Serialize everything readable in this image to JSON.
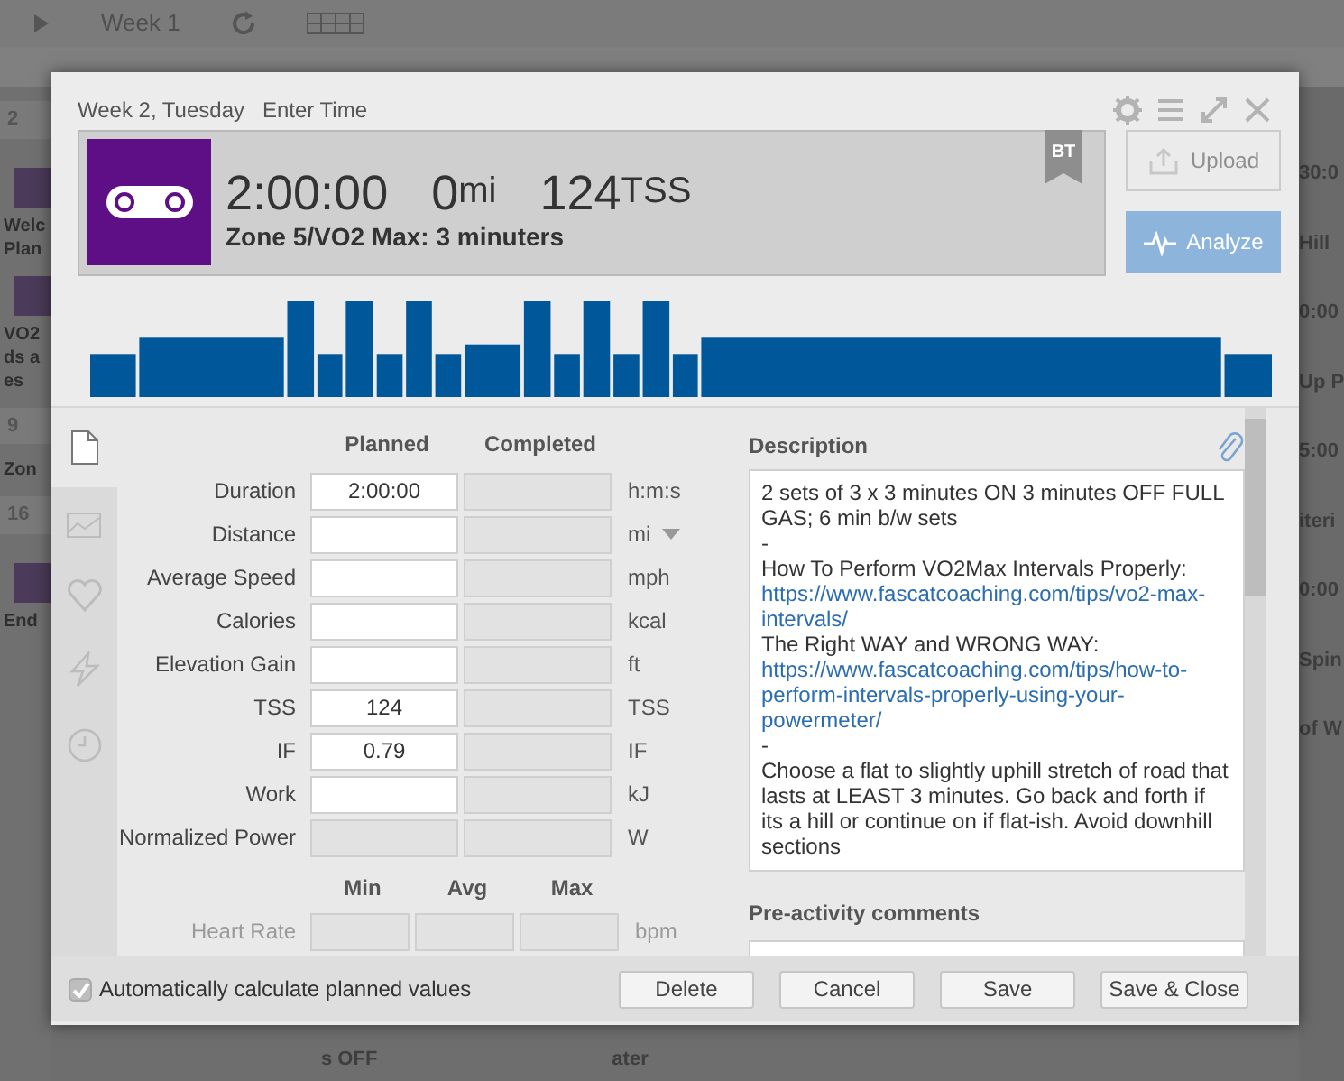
{
  "background": {
    "week_label": "Week 1",
    "left_column": [
      {
        "kind": "daynum",
        "text": "2"
      },
      {
        "kind": "icon"
      },
      {
        "kind": "text",
        "text": "Welc"
      },
      {
        "kind": "text",
        "text": "Plan"
      },
      {
        "kind": "icon"
      },
      {
        "kind": "text",
        "text": "VO2"
      },
      {
        "kind": "text",
        "text": "ds a"
      },
      {
        "kind": "text",
        "text": "es"
      },
      {
        "kind": "daynum",
        "text": "9"
      },
      {
        "kind": "text",
        "text": "Zon"
      },
      {
        "kind": "daynum",
        "text": "16"
      },
      {
        "kind": "icon"
      },
      {
        "kind": "text",
        "text": "End"
      }
    ],
    "right_column": [
      {
        "text": "30:0"
      },
      {
        "text": "Hill"
      },
      {
        "text": "0:00"
      },
      {
        "text": "Up P"
      },
      {
        "text": "5:00"
      },
      {
        "text": "iteri"
      },
      {
        "text": "0:00"
      },
      {
        "text": "Spin"
      },
      {
        "text": "of W"
      }
    ],
    "bottom_texts": [
      "s OFF",
      "ater"
    ]
  },
  "dialog": {
    "breadcrumb": "Week 2, Tuesday",
    "time_link": "Enter Time",
    "summary": {
      "duration": "2:00:00",
      "distance": "0",
      "distance_unit": "mi",
      "tss": "124",
      "tss_unit": "TSS",
      "title": "Zone 5/VO2 Max: 3 minuters",
      "badge": "BT"
    },
    "actions": [
      {
        "label": "Upload",
        "disabled": true
      },
      {
        "label": "Analyze",
        "disabled": false
      }
    ],
    "planned_header": "Planned",
    "completed_header": "Completed",
    "metrics": [
      {
        "label": "Duration",
        "planned": "2:00:00",
        "unit": "h:m:s",
        "planned_disabled": false
      },
      {
        "label": "Distance",
        "unit": "mi",
        "planned_disabled": false,
        "dropdown": true
      },
      {
        "label": "Average Speed",
        "unit": "mph",
        "planned_disabled": false
      },
      {
        "label": "Calories",
        "unit": "kcal",
        "planned_disabled": false
      },
      {
        "label": "Elevation Gain",
        "unit": "ft",
        "planned_disabled": false
      },
      {
        "label": "TSS",
        "planned": "124",
        "unit": "TSS",
        "planned_disabled": false
      },
      {
        "label": "IF",
        "planned": "0.79",
        "unit": "IF",
        "planned_disabled": false
      },
      {
        "label": "Work",
        "unit": "kJ",
        "planned_disabled": false
      },
      {
        "label": "Normalized Power",
        "unit": "W",
        "planned_disabled": true
      }
    ],
    "range_headers": [
      "Min",
      "Avg",
      "Max"
    ],
    "heart_rate": {
      "label": "Heart Rate",
      "unit": "bpm",
      "disabled": true
    },
    "description_label": "Description",
    "description": [
      {
        "kind": "text",
        "text": "2 sets of 3 x 3 minutes ON 3 minutes OFF FULL GAS; 6 min b/w sets"
      },
      {
        "kind": "text",
        "text": "-"
      },
      {
        "kind": "text",
        "text": "How To Perform VO2Max Intervals Properly:"
      },
      {
        "kind": "link",
        "text": "https://www.fascatcoaching.com/tips/vo2-max-intervals/"
      },
      {
        "kind": "text",
        "text": "The Right WAY and WRONG WAY:"
      },
      {
        "kind": "link",
        "text": "https://www.fascatcoaching.com/tips/how-to-perform-intervals-properly-using-your-powermeter/"
      },
      {
        "kind": "text",
        "text": "-"
      },
      {
        "kind": "text",
        "text": "Choose a flat to slightly uphill stretch of road that lasts at LEAST 3 minutes. Go back and forth if its a hill or continue on if flat-ish. Avoid downhill sections"
      }
    ],
    "comments_label": "Pre-activity comments",
    "auto_calculate": {
      "label": "Automatically calculate planned values",
      "checked": true
    },
    "buttons": [
      "Delete",
      "Cancel",
      "Save",
      "Save & Close"
    ]
  }
}
